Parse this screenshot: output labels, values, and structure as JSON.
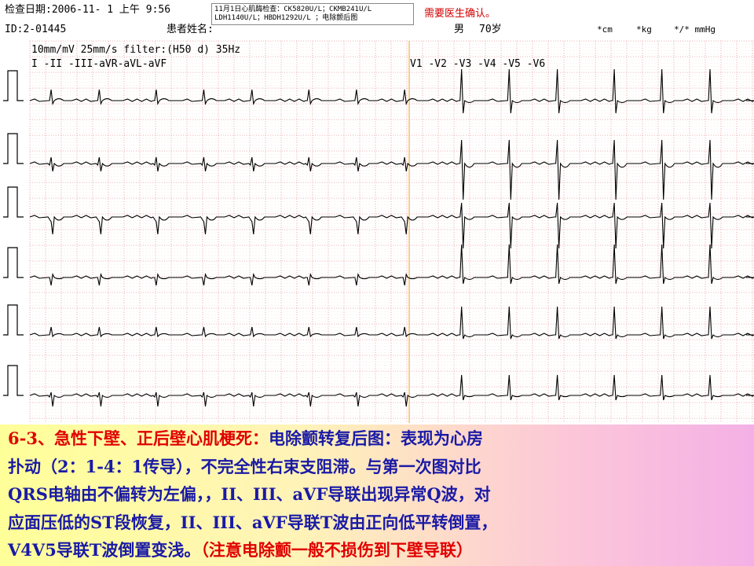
{
  "header": {
    "exam_date": "检查日期:2006-11- 1  上午 9:56",
    "patient_id": "ID:2-01445",
    "patient_name_label": "患者姓名:",
    "sex": "男",
    "age": "70岁",
    "height": "*cm",
    "weight": "*kg",
    "bp": "*/* mmHg"
  },
  "lab_note": {
    "line1": "11月1日心肌酶检查：CK5820U/L；CKMB241U/L",
    "line2": "LDH1140U/L；HBDH1292U/L  ；电除颤后图"
  },
  "confirm_note": "需要医生确认。",
  "ecg": {
    "settings": "10mm/mV 25mm/s filter:(H50 d) 35Hz",
    "limb_leads_label": "I  -II -III-aVR-aVL-aVF",
    "chest_leads_label": "V1 -V2 -V3 -V4 -V5 -V6",
    "colors": {
      "grid_major": "#e27a7a",
      "grid_minor": "#f6c9c9",
      "trace": "#000000",
      "divider": "#f0a030"
    }
  },
  "caption": {
    "red_lead": "6-3、急性下壁、正后壁心肌梗死：",
    "line1_rest": "电除颤转复后图：表现为心房",
    "line2": "扑动（2：1-4：1传导），不完全性右束支阻滞。与第一次图对比",
    "line3": "QRS电轴由不偏转为左偏，，II、III、aVF导联出现异常Q波，对",
    "line4": "应面压低的ST段恢复，II、III、aVF导联T波由正向低平转倒置，",
    "line5_blue": "V4V5导联T波倒置变浅。",
    "line5_red": "（注意电除颤一般不损伤到下壁导联）",
    "colors": {
      "blue": "#1a1aa6",
      "red": "#e00000"
    }
  }
}
